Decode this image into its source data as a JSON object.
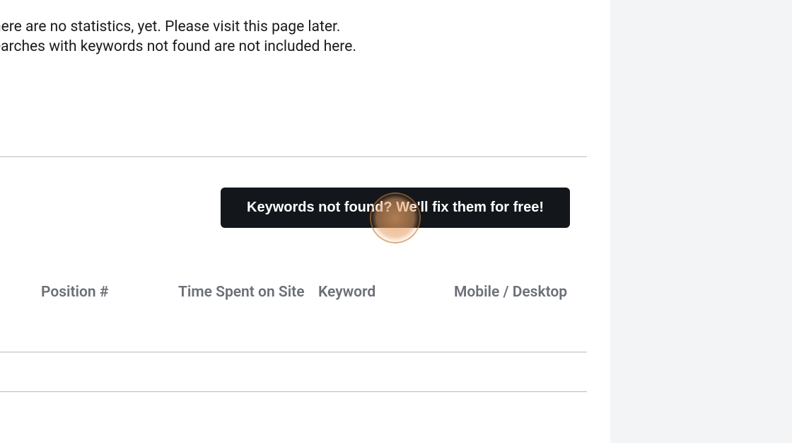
{
  "info": {
    "line1": "here are no statistics, yet. Please visit this page later.",
    "line2": "earches with keywords not found are not included here."
  },
  "cta": {
    "label": "Keywords not found? We'll fix them for free!"
  },
  "table": {
    "headers": {
      "position": "Position #",
      "time": "Time Spent on Site",
      "keyword": "Keyword",
      "mobile": "Mobile / Desktop"
    }
  }
}
